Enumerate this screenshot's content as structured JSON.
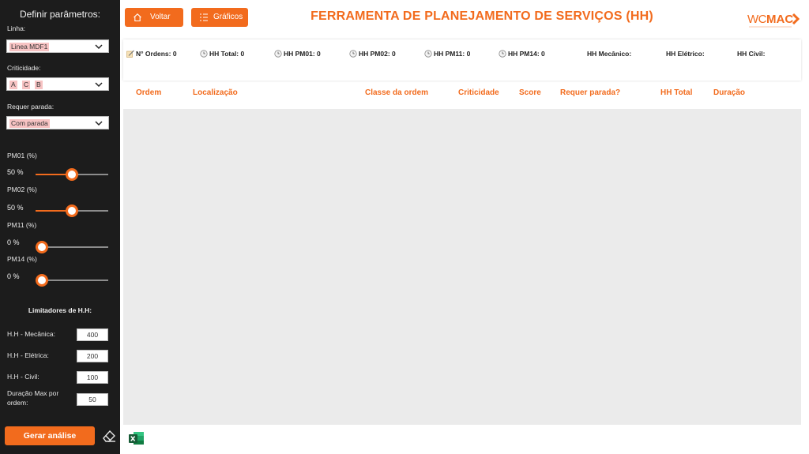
{
  "sidebar": {
    "title": "Definir parâmetros:",
    "linha_label": "Linha:",
    "linha_value": "Linea MDF1",
    "criticidade_label": "Criticidade:",
    "criticidade_chips": [
      "A",
      "C",
      "B"
    ],
    "parada_label": "Requer parada:",
    "parada_value": "Com parada",
    "sliders": [
      {
        "label": "PM01 (%)",
        "value_text": "50 %",
        "value": 0.5
      },
      {
        "label": "PM02 (%)",
        "value_text": "50 %",
        "value": 0.5
      },
      {
        "label": "PM11 (%)",
        "value_text": "0 %",
        "value": 0.0
      },
      {
        "label": "PM14 (%)",
        "value_text": "0 %",
        "value": 0.0
      }
    ],
    "limits_title": "Limitadores de H.H:",
    "limits": [
      {
        "label": "H.H - Mecânica:",
        "value": "400"
      },
      {
        "label": "H.H - Elétrica:",
        "value": "200"
      },
      {
        "label": "H.H - Civil:",
        "value": "100"
      },
      {
        "label": "Duração Max por ordem:",
        "value": "50"
      }
    ],
    "gerar_label": "Gerar análise"
  },
  "header": {
    "voltar_label": "Voltar",
    "graficos_label": "Gráficos",
    "title": "FERRAMENTA DE PLANEJAMENTO DE SERVIÇOS (HH)",
    "logo_text": "WC MAC"
  },
  "summary": {
    "ordens": "N° Ordens: 0",
    "hh_total": "HH Total: 0",
    "hh_pm01": "HH PM01: 0",
    "hh_pm02": "HH PM02: 0",
    "hh_pm11": "HH PM11: 0",
    "hh_pm14": "HH PM14: 0",
    "hh_mecanico": "HH Mecânico:",
    "hh_eletrico": "HH Elétrico:",
    "hh_civil": "HH Civil:"
  },
  "table": {
    "columns": [
      "Ordem",
      "Localização",
      "Classe da ordem",
      "Criticidade",
      "Score",
      "Requer parada?",
      "HH Total",
      "Duração"
    ]
  },
  "colors": {
    "accent": "#f26b1d",
    "sidebar_bg": "#1c1c1c",
    "table_body_bg": "#ebebeb"
  }
}
